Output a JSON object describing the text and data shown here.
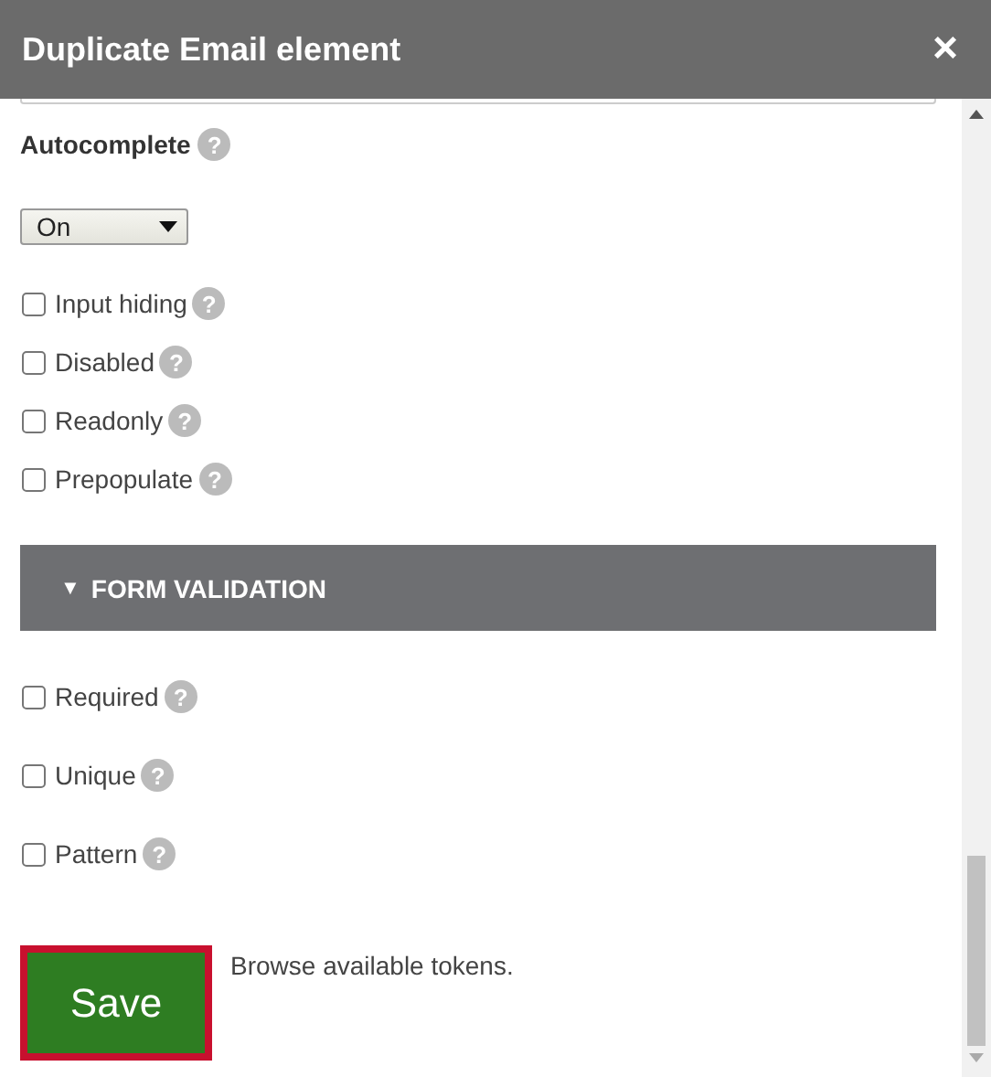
{
  "window": {
    "title": "Duplicate Email element",
    "close": "×"
  },
  "autocomplete": {
    "label": "Autocomplete",
    "help": "?",
    "value": "On"
  },
  "options": [
    {
      "label": "Input hiding",
      "checked": false,
      "help": "?"
    },
    {
      "label": "Disabled",
      "checked": false,
      "help": "?"
    },
    {
      "label": "Readonly",
      "checked": false,
      "help": "?"
    },
    {
      "label": "Prepopulate",
      "checked": false,
      "help": "?"
    }
  ],
  "section": {
    "toggle": "▼",
    "title": "FORM VALIDATION",
    "expanded": true
  },
  "validation": [
    {
      "label": "Required",
      "checked": false,
      "help": "?"
    },
    {
      "label": "Unique",
      "checked": false,
      "help": "?"
    },
    {
      "label": "Pattern",
      "checked": false,
      "help": "?"
    }
  ],
  "save_button": "Save",
  "tokens_link": "Browse available tokens."
}
